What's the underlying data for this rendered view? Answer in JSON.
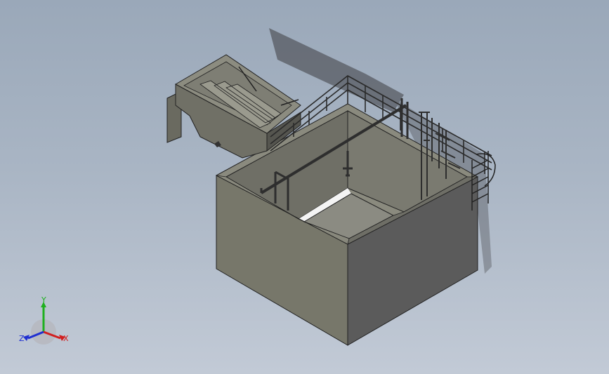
{
  "viewport": {
    "background_top": "#9aa8b9",
    "background_bottom": "#c2cad6",
    "model": {
      "wall_left_color": "#77776a",
      "wall_right_color": "#5a5a5a",
      "wall_top_color": "#8a8a7e",
      "floor_color": "#8b8b82",
      "railing_color": "#2a2a2a",
      "pipe_color": "#3a3a3a"
    }
  },
  "triad": {
    "x_label": "X",
    "y_label": "Y",
    "z_label": "Z",
    "x_color": "#d11f1f",
    "y_color": "#1fb01f",
    "z_color": "#1f2fd1"
  }
}
